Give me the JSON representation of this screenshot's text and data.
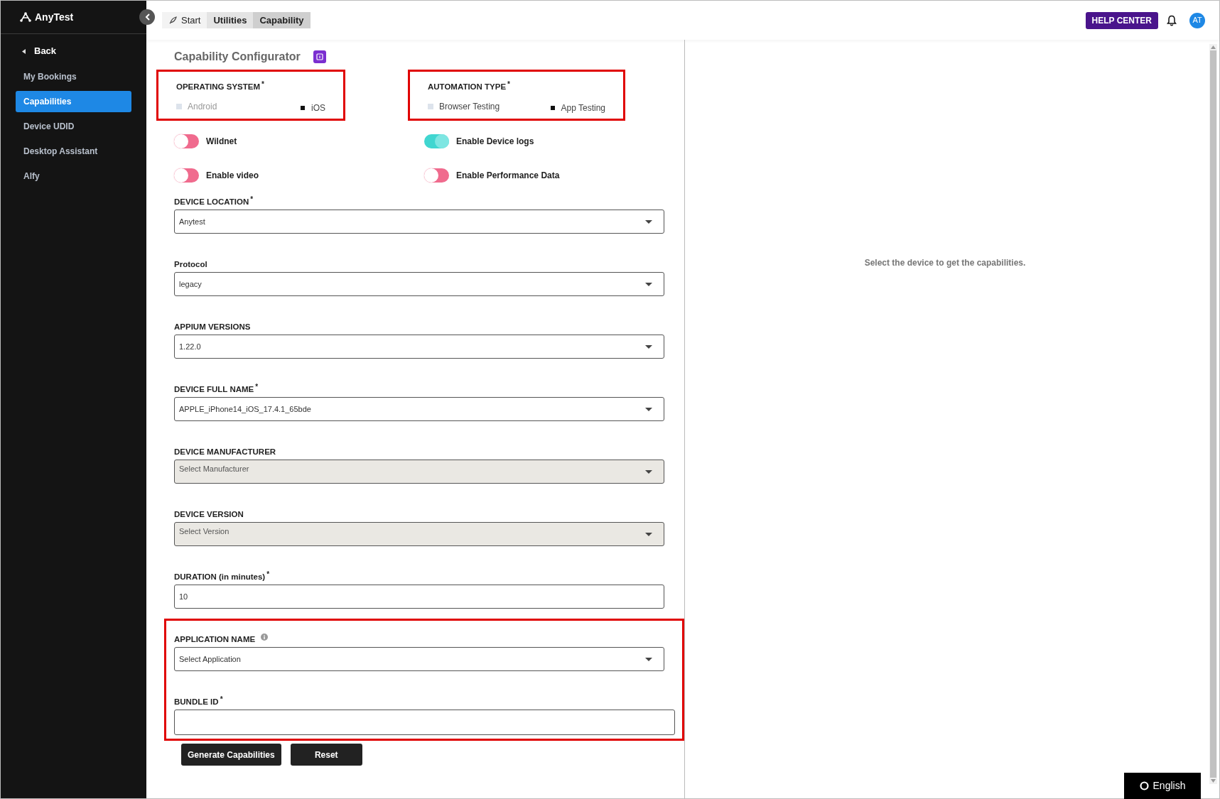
{
  "sidebar": {
    "logo": "AnyTest",
    "back": "Back",
    "items": [
      {
        "label": "My Bookings",
        "selected": false
      },
      {
        "label": "Capabilities",
        "selected": true
      },
      {
        "label": "Device UDID",
        "selected": false
      },
      {
        "label": "Desktop Assistant",
        "selected": false
      },
      {
        "label": "Alfy",
        "selected": false
      }
    ]
  },
  "breadcrumbs": [
    {
      "label": "Start",
      "kind": "start",
      "selected": false
    },
    {
      "label": "Utilities",
      "kind": "plain",
      "selected": false
    },
    {
      "label": "Capability",
      "kind": "plain",
      "selected": true
    }
  ],
  "header": {
    "help_button": "HELP CENTER",
    "avatar": "AT"
  },
  "configurator": {
    "title": "Capability Configurator",
    "radio_groups": [
      {
        "label": "OPERATING SYSTEM",
        "required_mark": "*",
        "highlighted": true,
        "options": [
          {
            "label": "Android",
            "selected": false
          },
          {
            "label": "iOS",
            "selected": true
          }
        ]
      },
      {
        "label": "AUTOMATION TYPE",
        "required_mark": "*",
        "highlighted": true,
        "options": [
          {
            "label": "Browser Testing",
            "selected": false
          },
          {
            "label": "App Testing",
            "selected": true
          }
        ]
      }
    ],
    "toggles": [
      {
        "label": "Wildnet",
        "on": false
      },
      {
        "label": "Enable Device logs",
        "on": true
      },
      {
        "label": "Enable video",
        "on": false
      },
      {
        "label": "Enable Performance Data",
        "on": false
      }
    ],
    "fields": [
      {
        "label": "DEVICE LOCATION",
        "required_mark": "*",
        "kind": "select",
        "value": "Anytest",
        "disabled": false
      },
      {
        "label": "Protocol",
        "kind": "select",
        "value": "legacy",
        "disabled": false
      },
      {
        "label": "APPIUM VERSIONS",
        "kind": "select",
        "value": "1.22.0",
        "disabled": false
      },
      {
        "label": "DEVICE FULL NAME",
        "required_mark": "*",
        "kind": "select",
        "value": "APPLE_iPhone14_iOS_17.4.1_65bde",
        "disabled": false
      },
      {
        "label": "DEVICE MANUFACTURER",
        "kind": "select",
        "placeholder": "Select Manufacturer",
        "disabled": true
      },
      {
        "label": "DEVICE VERSION",
        "kind": "select",
        "placeholder": "Select Version",
        "disabled": true
      },
      {
        "label": "DURATION (in minutes)",
        "required_mark": "*",
        "kind": "input",
        "value": "10",
        "disabled": false
      },
      {
        "label": "APPLICATION NAME",
        "info": true,
        "kind": "select",
        "placeholder": "Select Application",
        "disabled": false,
        "highlighted": true
      },
      {
        "label": "BUNDLE ID",
        "required_mark": "*",
        "kind": "input",
        "disabled": false,
        "highlighted": true
      }
    ],
    "buttons": [
      "Generate Capabilities",
      "Reset"
    ]
  },
  "panel_message": "Select the device to get the capabilities.",
  "language_button": "English"
}
